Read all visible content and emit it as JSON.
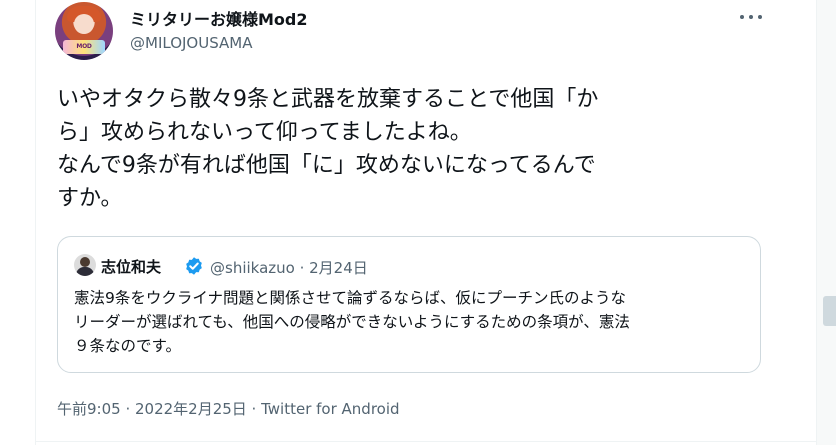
{
  "author": {
    "display_name": "ミリタリーお嬢様Mod2",
    "handle": "@MILOJOUSAMA",
    "avatar_icon": "anime-girl-avatar"
  },
  "tweet": {
    "lines": [
      "いやオタクら散々9条と武器を放棄することで他国「か",
      "ら」攻められないって仰ってましたよね。",
      "なんで9条が有れば他国「に」攻めないになってるんで",
      "すか。"
    ],
    "timestamp": "午前9:05 · 2022年2月25日 · Twitter for Android"
  },
  "quoted_tweet": {
    "display_name": "志位和夫",
    "verified_icon": "verified-badge-icon",
    "meta": "@shiikazuo · 2月24日",
    "lines": [
      "憲法9条をウクライナ問題と関係させて論ずるならば、仮にプーチン氏のような",
      "リーダーが選ばれても、他国への侵略ができないようにするための条項が、憲法",
      "９条なのです。"
    ]
  },
  "icons": {
    "more": "more-options-icon"
  },
  "colors": {
    "text_primary": "#0f1419",
    "text_secondary": "#536471",
    "border": "#cfd9de",
    "verified": "#1d9bf0"
  }
}
